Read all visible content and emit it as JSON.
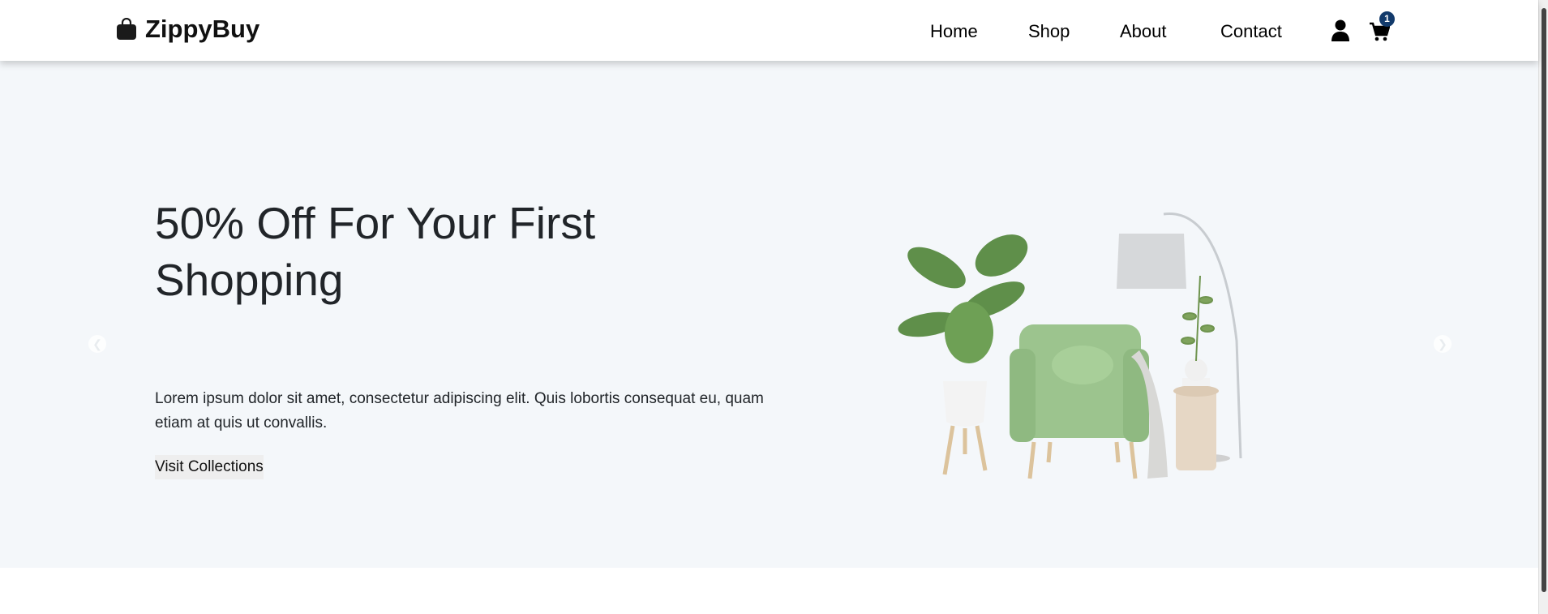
{
  "brand": {
    "name": "ZippyBuy"
  },
  "nav": {
    "items": [
      "Home",
      "Shop",
      "About",
      "Contact"
    ],
    "cart_count": "1"
  },
  "hero": {
    "title": "50% Off For Your First Shopping",
    "description": "Lorem ipsum dolor sit amet, consectetur adipiscing elit. Quis lobortis consequat eu, quam etiam at quis ut convallis.",
    "button": "Visit Collections"
  },
  "colors": {
    "hero_bg": "#f4f7fa",
    "badge": "#123a6b",
    "chair": "#9cc48e"
  }
}
